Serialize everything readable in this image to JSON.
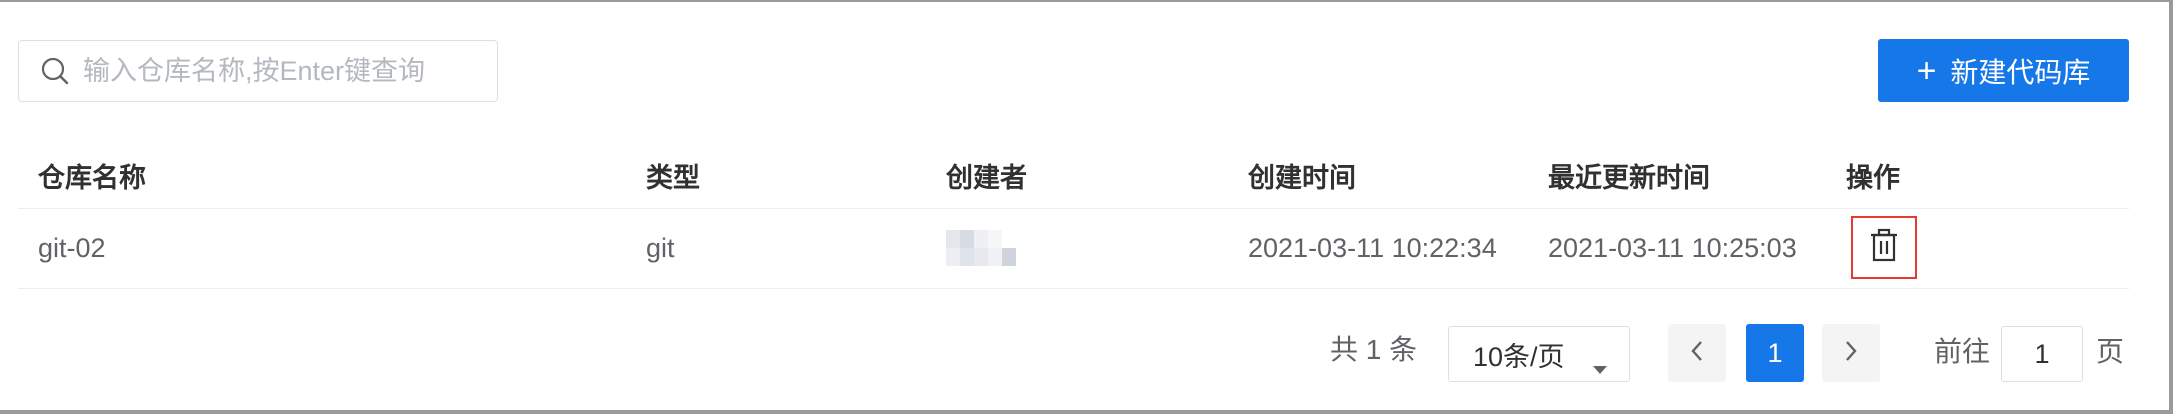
{
  "search": {
    "placeholder": "输入仓库名称,按Enter键查询",
    "value": ""
  },
  "toolbar": {
    "new_label": "新建代码库"
  },
  "table": {
    "columns": [
      "仓库名称",
      "类型",
      "创建者",
      "创建时间",
      "最近更新时间",
      "操作"
    ],
    "rows": [
      {
        "name": "git-02",
        "type": "git",
        "creator": "",
        "created": "2021-03-11 10:22:34",
        "updated": "2021-03-11 10:25:03"
      }
    ]
  },
  "pagination": {
    "total_label": "共 1 条",
    "page_size_label": "10条/页",
    "current_page": "1",
    "goto_prefix": "前往",
    "goto_value": "1",
    "goto_suffix": "页"
  },
  "colors": {
    "primary": "#1677e8",
    "highlight_border": "#e53935"
  }
}
